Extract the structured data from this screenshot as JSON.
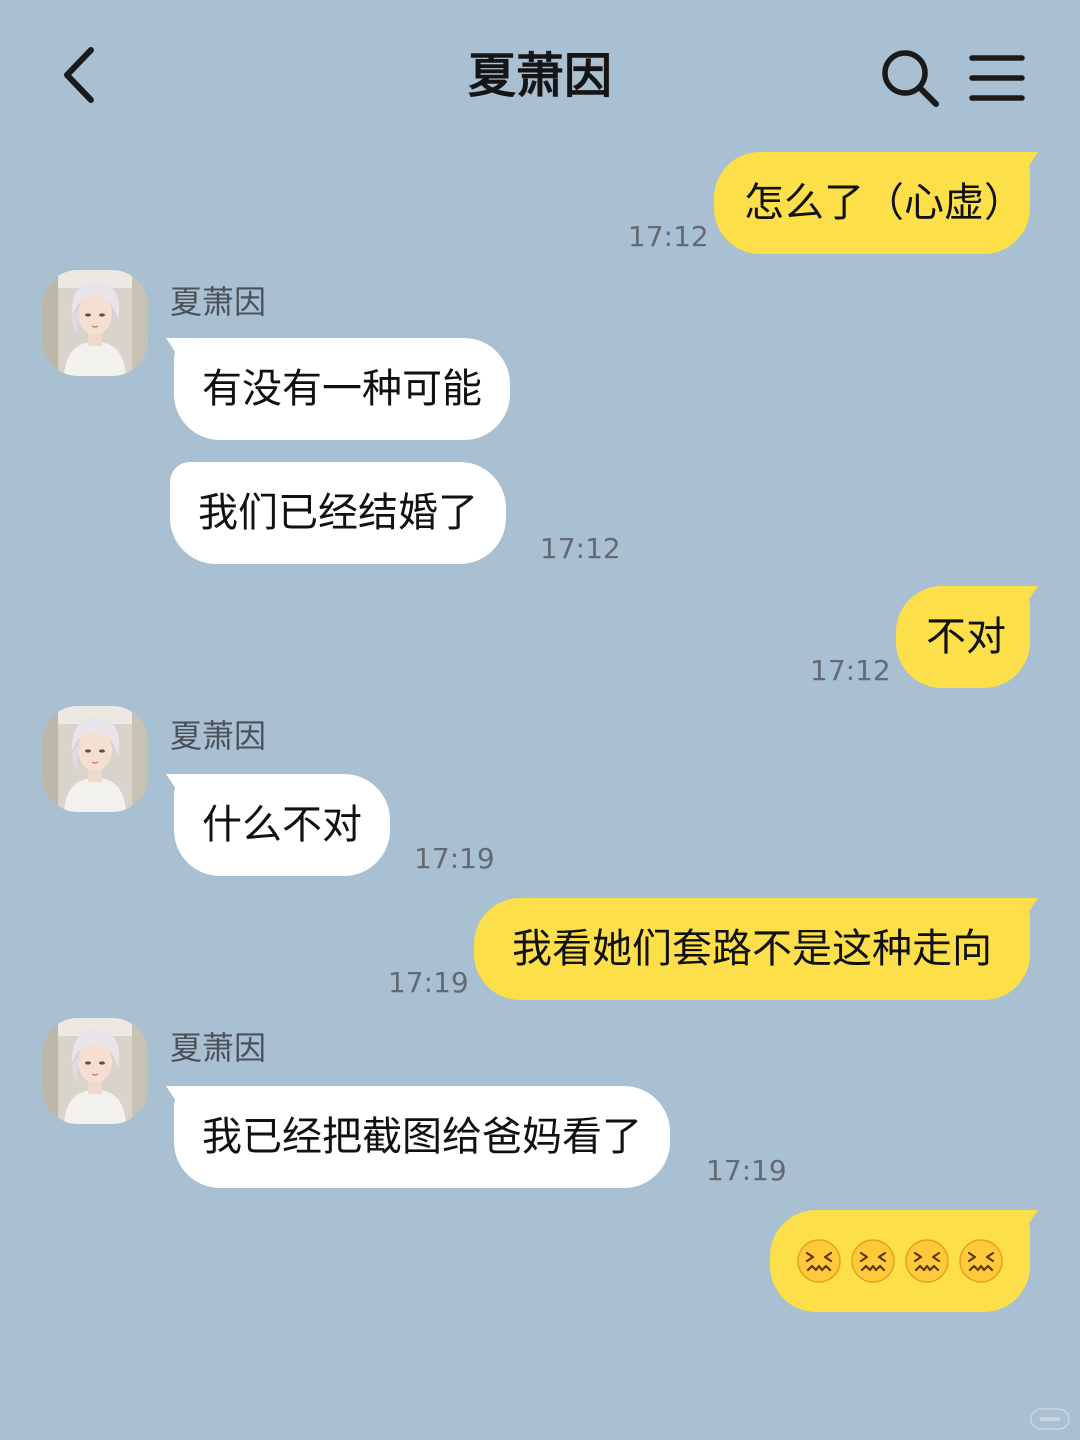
{
  "header": {
    "title": "夏萧因"
  },
  "messages": [
    {
      "dir": "out",
      "text": "怎么了（心虚）",
      "time": "17:12"
    },
    {
      "dir": "in",
      "sender": "夏萧因",
      "text": "有没有一种可能"
    },
    {
      "dir": "in",
      "text": "我们已经结婚了",
      "time": "17:12"
    },
    {
      "dir": "out",
      "text": "不对",
      "time": "17:12"
    },
    {
      "dir": "in",
      "sender": "夏萧因",
      "text": "什么不对",
      "time": "17:19"
    },
    {
      "dir": "out",
      "text": "我看她们套路不是这种走向",
      "time": "17:19"
    },
    {
      "dir": "in",
      "sender": "夏萧因",
      "text": "我已经把截图给爸妈看了",
      "time": "17:19"
    },
    {
      "dir": "out",
      "emoji": "confounded-face",
      "emoji_count": 4
    }
  ],
  "colors": {
    "background": "#a9c0d3",
    "outgoing_bubble": "#fde049",
    "incoming_bubble": "#ffffff",
    "timestamp": "#636a72"
  }
}
